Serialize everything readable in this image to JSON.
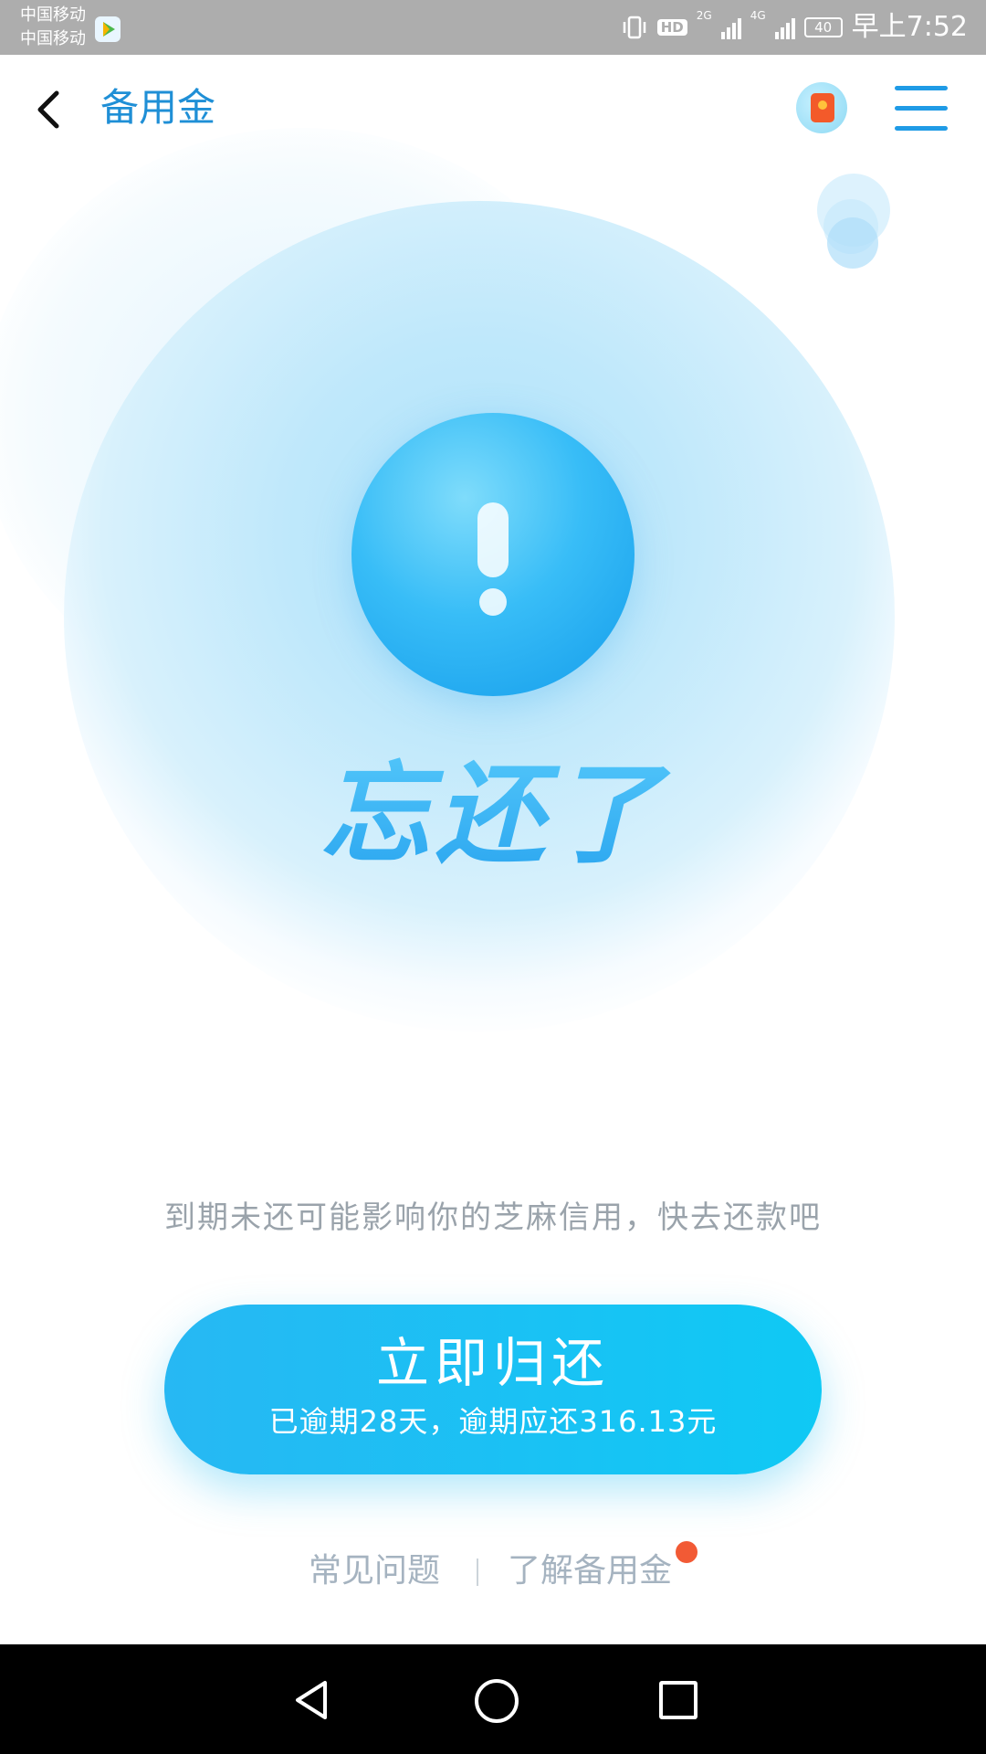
{
  "status_bar": {
    "carrier_1": "中国移动",
    "carrier_2": "中国移动",
    "hd": "HD",
    "net_1": "2G",
    "net_2": "4G",
    "battery": "40",
    "time": "早上7:52"
  },
  "header": {
    "title": "备用金",
    "icons": [
      "back-icon",
      "red-packet-icon",
      "menu-icon"
    ]
  },
  "hero": {
    "icon": "exclamation-icon",
    "headline": "忘还了"
  },
  "notice": "到期未还可能影响你的芝麻信用，快去还款吧",
  "repay_button": {
    "label": "立即归还",
    "sub": "已逾期28天，逾期应还316.13元"
  },
  "links": {
    "faq": "常见问题",
    "about": "了解备用金"
  },
  "colors": {
    "accent": "#1f9be6",
    "button": "#1cc1f4",
    "status_bar": "#adadad",
    "badge_dot": "#f25a35"
  }
}
